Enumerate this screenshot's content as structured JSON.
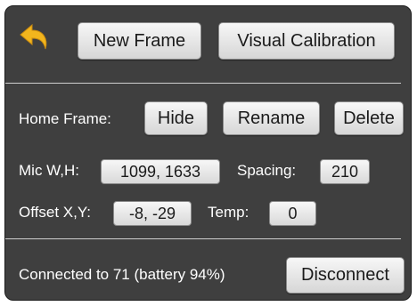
{
  "toolbar": {
    "back_icon": "back-arrow-icon",
    "new_frame": "New Frame",
    "visual_calibration": "Visual Calibration"
  },
  "home_frame": {
    "label": "Home Frame:",
    "hide": "Hide",
    "rename": "Rename",
    "delete": "Delete"
  },
  "mic": {
    "label": "Mic W,H:",
    "value": "1099, 1633",
    "spacing_label": "Spacing:",
    "spacing_value": "210"
  },
  "offset": {
    "label": "Offset X,Y:",
    "value": "-8, -29",
    "temp_label": "Temp:",
    "temp_value": "0"
  },
  "connection": {
    "status": "Connected to 71 (battery 94%)",
    "disconnect": "Disconnect"
  },
  "colors": {
    "panel": "#3f3f3f",
    "accent": "#f2b51d"
  }
}
